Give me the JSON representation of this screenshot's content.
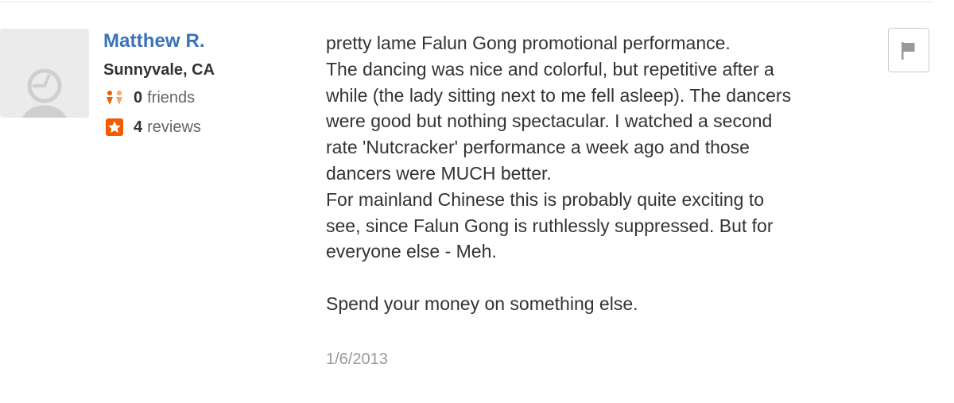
{
  "reviewer": {
    "name": "Matthew R.",
    "location": "Sunnyvale, CA",
    "friends_count": "0",
    "friends_label": "friends",
    "reviews_count": "4",
    "reviews_label": "reviews"
  },
  "review": {
    "lines": [
      "pretty lame Falun Gong promotional performance.",
      "The dancing was nice and colorful, but repetitive after a",
      "while (the lady sitting next to me fell asleep).  The dancers",
      "were good but nothing spectacular.  I watched a second",
      "rate 'Nutcracker' performance a week ago and those",
      "dancers were MUCH better.",
      "For mainland Chinese this is probably quite exciting to",
      "see, since Falun Gong is ruthlessly suppressed.  But for",
      "everyone else - Meh."
    ],
    "closing": "Spend your money on something else.",
    "date": "1/6/2013"
  },
  "icons": {
    "avatar": "default-user-avatar-icon",
    "friends": "friends-icon",
    "reviews": "star-badge-icon",
    "flag": "flag-icon"
  },
  "colors": {
    "name_link": "#3b72bb",
    "friends_icon": "#f15c00",
    "reviews_icon": "#f15c00",
    "muted_text": "#999999"
  }
}
